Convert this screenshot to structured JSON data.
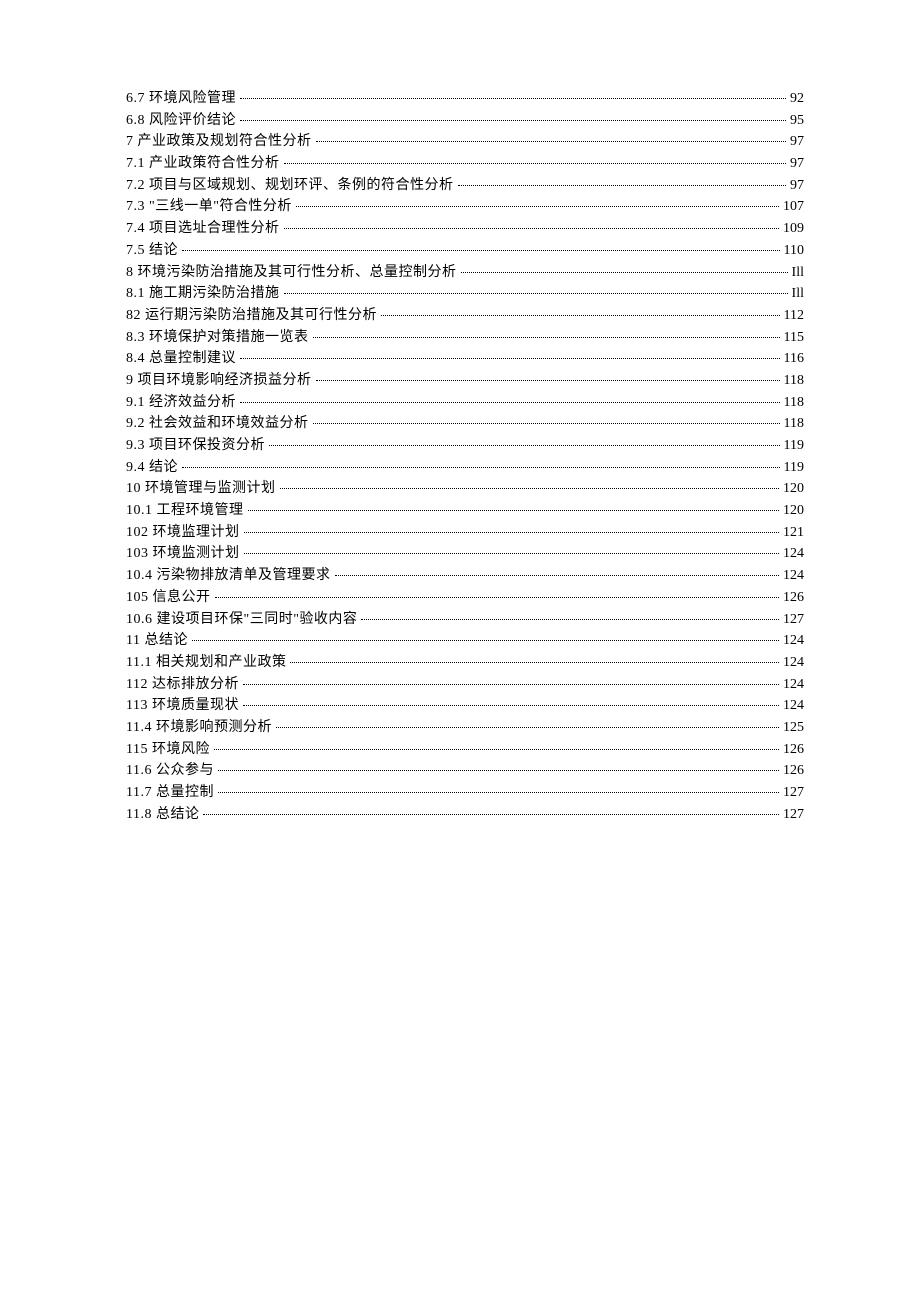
{
  "toc": [
    {
      "num": "6.7",
      "title": "环境风险管理",
      "page": "92"
    },
    {
      "num": "6.8",
      "title": "风险评价结论",
      "page": "95"
    },
    {
      "num": "7",
      "title": "产业政策及规划符合性分析",
      "page": "97"
    },
    {
      "num": "7.1",
      "title": "产业政策符合性分析",
      "page": "97"
    },
    {
      "num": "7.2",
      "title": "项目与区域规划、规划环评、条例的符合性分析",
      "page": "97"
    },
    {
      "num": "7.3",
      "title": "\"三线一单\"符合性分析",
      "page": "107"
    },
    {
      "num": "7.4",
      "title": "项目选址合理性分析",
      "page": "109"
    },
    {
      "num": "7.5",
      "title": "结论",
      "page": "110"
    },
    {
      "num": "8",
      "title": "环境污染防治措施及其可行性分析、总量控制分析",
      "page": "Ill"
    },
    {
      "num": "8.1",
      "title": "施工期污染防治措施",
      "page": "Ill"
    },
    {
      "num": "82",
      "title": "运行期污染防治措施及其可行性分析",
      "page": "112"
    },
    {
      "num": "8.3",
      "title": "环境保护对策措施一览表",
      "page": "115"
    },
    {
      "num": "8.4",
      "title": "总量控制建议",
      "page": "116"
    },
    {
      "num": "9",
      "title": "项目环境影响经济损益分析",
      "page": "118"
    },
    {
      "num": "9.1",
      "title": "经济效益分析",
      "page": "118"
    },
    {
      "num": "9.2",
      "title": "社会效益和环境效益分析",
      "page": "118"
    },
    {
      "num": "9.3",
      "title": "项目环保投资分析",
      "page": "119"
    },
    {
      "num": "9.4",
      "title": "结论",
      "page": "119"
    },
    {
      "num": "10",
      "title": "环境管理与监测计划",
      "page": "120"
    },
    {
      "num": "10.1",
      "title": "工程环境管理",
      "page": "120"
    },
    {
      "num": "102",
      "title": "环境监理计划",
      "page": "121"
    },
    {
      "num": "103",
      "title": "环境监测计划",
      "page": "124"
    },
    {
      "num": "10.4",
      "title": "污染物排放清单及管理要求",
      "page": "124"
    },
    {
      "num": "105",
      "title": "信息公开",
      "page": "126"
    },
    {
      "num": "10.6",
      "title": "建设项目环保\"三同时\"验收内容",
      "page": "127"
    },
    {
      "num": "11",
      "title": "总结论",
      "page": "124"
    },
    {
      "num": "11.1",
      "title": "相关规划和产业政策",
      "page": "124"
    },
    {
      "num": "112",
      "title": "达标排放分析",
      "page": "124"
    },
    {
      "num": "113",
      "title": "环境质量现状",
      "page": "124"
    },
    {
      "num": "11.4",
      "title": "环境影响预测分析",
      "page": "125"
    },
    {
      "num": "115",
      "title": "环境风险",
      "page": "126"
    },
    {
      "num": "11.6",
      "title": "公众参与",
      "page": "126"
    },
    {
      "num": "11.7",
      "title": "总量控制",
      "page": "127"
    },
    {
      "num": "11.8",
      "title": "总结论",
      "page": "127"
    }
  ]
}
